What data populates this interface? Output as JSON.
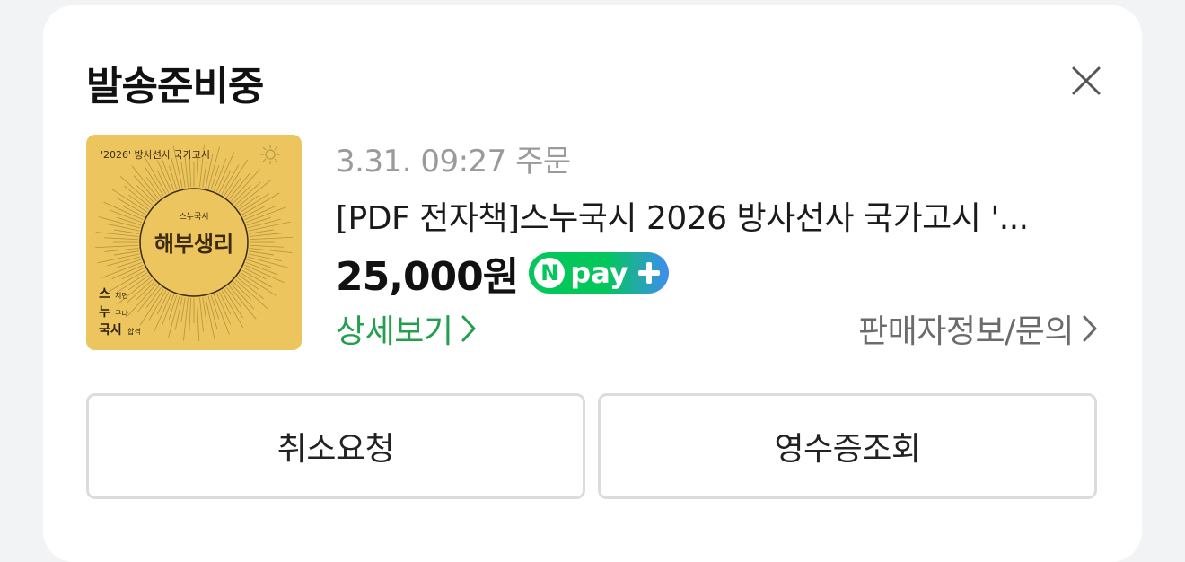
{
  "status_title": "발송준비중",
  "order": {
    "date_text": "3.31. 09:27 주문",
    "product_name": "[PDF 전자책]스누국시 2026 방사선사 국가고시 '...",
    "price": "25,000원",
    "pay_badge": {
      "n": "N",
      "label": "pay"
    },
    "detail_link": "상세보기",
    "seller_link": "판매자정보/문의"
  },
  "thumbnail": {
    "top_text": "'2026' 방사선사 국가고시",
    "brand_small": "스누국시",
    "main_title": "해부생리",
    "side_lines": [
      {
        "big": "스",
        "small": "치면"
      },
      {
        "big": "누",
        "small": "구나"
      },
      {
        "big": "국시",
        "small": "합격"
      }
    ]
  },
  "actions": {
    "cancel_label": "취소요청",
    "receipt_label": "영수증조회"
  },
  "colors": {
    "accent_green": "#22a04e",
    "npay_green": "#03c75a",
    "npay_blue": "#3e8df0",
    "thumb_yellow": "#ecc55e"
  },
  "icons": [
    "close-icon",
    "chevron-right-icon",
    "npay-plus-icon"
  ]
}
